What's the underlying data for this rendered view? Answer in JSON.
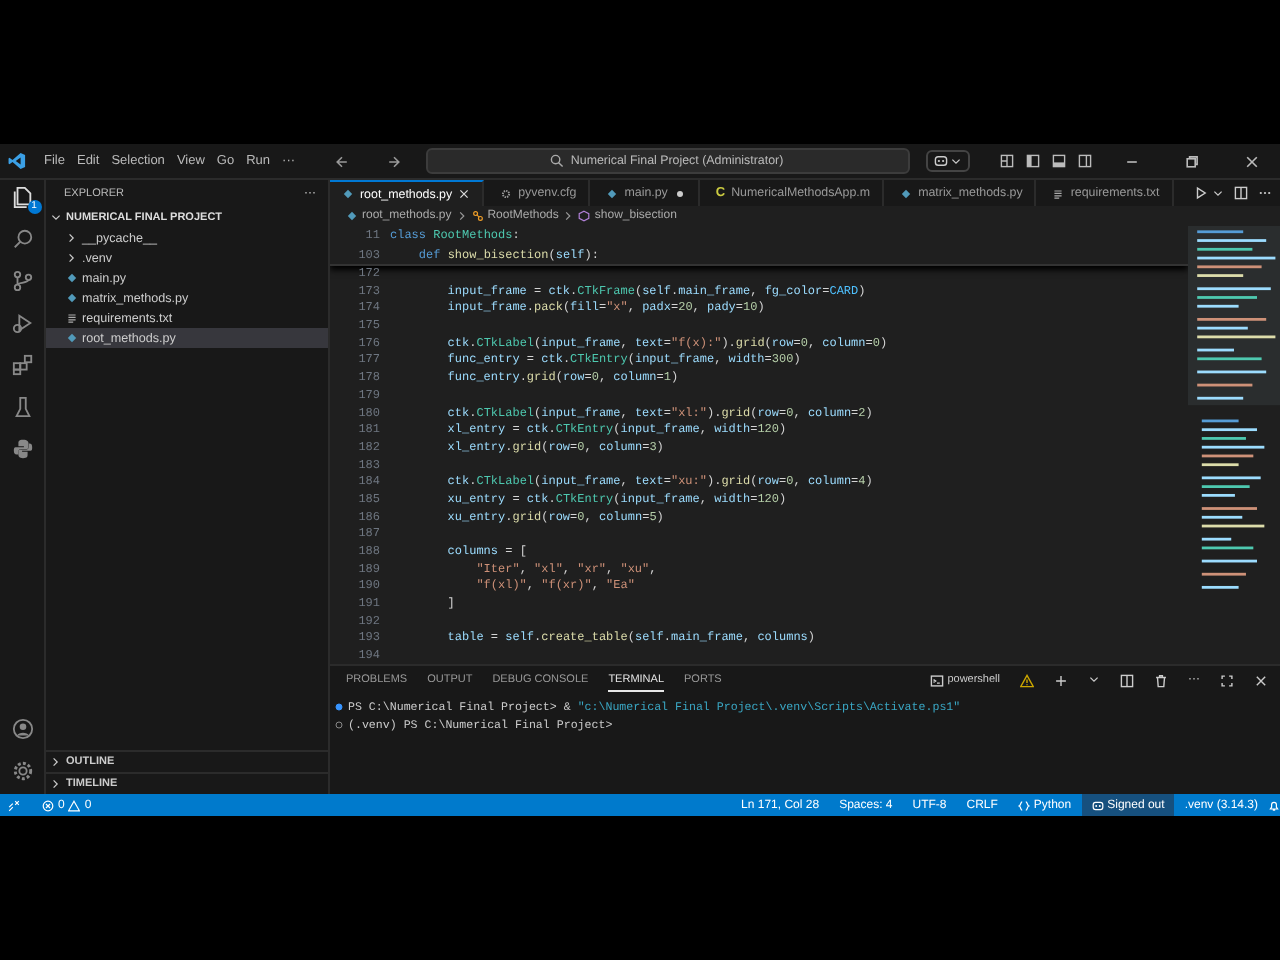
{
  "title_bar": {
    "menus": [
      "File",
      "Edit",
      "Selection",
      "View",
      "Go",
      "Run"
    ],
    "more": "···",
    "search": "Numerical Final Project (Administrator)"
  },
  "activity_bar": {
    "badge": "1"
  },
  "explorer": {
    "title": "EXPLORER",
    "more": "···",
    "project": {
      "label": "NUMERICAL FINAL PROJECT",
      "expanded": true,
      "children": [
        {
          "label": "__pycache__",
          "kind": "folder",
          "expanded": false,
          "selected": false
        },
        {
          "label": ".venv",
          "kind": "folder",
          "expanded": false,
          "selected": false
        },
        {
          "label": "main.py",
          "kind": "py",
          "selected": false
        },
        {
          "label": "matrix_methods.py",
          "kind": "py",
          "selected": false
        },
        {
          "label": "requirements.txt",
          "kind": "txt",
          "selected": false
        },
        {
          "label": "root_methods.py",
          "kind": "py",
          "selected": true
        }
      ]
    },
    "sections": [
      {
        "label": "OUTLINE",
        "expanded": false
      },
      {
        "label": "TIMELINE",
        "expanded": false
      }
    ]
  },
  "tabs": [
    {
      "label": "root_methods.py",
      "kind": "py",
      "selected": true,
      "modified": false
    },
    {
      "label": "pyvenv.cfg",
      "kind": "cfg",
      "selected": false,
      "modified": false
    },
    {
      "label": "main.py",
      "kind": "py",
      "selected": false,
      "modified": true
    },
    {
      "label": "NumericalMethodsApp.m",
      "kind": "letter",
      "letter": "C",
      "selected": false,
      "modified": false
    },
    {
      "label": "matrix_methods.py",
      "kind": "py",
      "selected": false,
      "modified": false
    },
    {
      "label": "requirements.txt",
      "kind": "txt",
      "selected": false,
      "modified": false
    }
  ],
  "breadcrumb": [
    {
      "label": "root_methods.py",
      "kind": "py"
    },
    {
      "label": "RootMethods",
      "kind": "class"
    },
    {
      "label": "show_bisection",
      "kind": "method"
    }
  ],
  "sticky_lines": [
    {
      "number": "11",
      "tokens": [
        {
          "text": "class ",
          "kind": "kw"
        },
        {
          "text": "RootMethods",
          "kind": "cls"
        },
        {
          "text": ":",
          "kind": "op"
        }
      ]
    },
    {
      "number": "103",
      "tokens": [
        {
          "text": "    def ",
          "kind": "kw"
        },
        {
          "text": "show_bisection",
          "kind": "fn"
        },
        {
          "text": "(",
          "kind": "op"
        },
        {
          "text": "self",
          "kind": "var"
        },
        {
          "text": "):",
          "kind": "op"
        }
      ]
    }
  ],
  "code_lines": [
    {
      "number": "172"
    },
    {
      "number": "173",
      "tokens": [
        {
          "text": "        input_frame",
          "kind": "var"
        },
        {
          "text": " = ",
          "kind": "op"
        },
        {
          "text": "ctk",
          "kind": "var"
        },
        {
          "text": ".",
          "kind": "op"
        },
        {
          "text": "CTkFrame",
          "kind": "cls"
        },
        {
          "text": "(",
          "kind": "op"
        },
        {
          "text": "self",
          "kind": "var"
        },
        {
          "text": ".",
          "kind": "op"
        },
        {
          "text": "main_frame",
          "kind": "var"
        },
        {
          "text": ", ",
          "kind": "op"
        },
        {
          "text": "fg_color",
          "kind": "var"
        },
        {
          "text": "=",
          "kind": "op"
        },
        {
          "text": "CARD",
          "kind": "const"
        },
        {
          "text": ")",
          "kind": "op"
        }
      ]
    },
    {
      "number": "174",
      "tokens": [
        {
          "text": "        input_frame",
          "kind": "var"
        },
        {
          "text": ".",
          "kind": "op"
        },
        {
          "text": "pack",
          "kind": "fn"
        },
        {
          "text": "(",
          "kind": "op"
        },
        {
          "text": "fill",
          "kind": "var"
        },
        {
          "text": "=",
          "kind": "op"
        },
        {
          "text": "\"x\"",
          "kind": "str"
        },
        {
          "text": ", ",
          "kind": "op"
        },
        {
          "text": "padx",
          "kind": "var"
        },
        {
          "text": "=",
          "kind": "op"
        },
        {
          "text": "20",
          "kind": "num"
        },
        {
          "text": ", ",
          "kind": "op"
        },
        {
          "text": "pady",
          "kind": "var"
        },
        {
          "text": "=",
          "kind": "op"
        },
        {
          "text": "10",
          "kind": "num"
        },
        {
          "text": ")",
          "kind": "op"
        }
      ]
    },
    {
      "number": "175"
    },
    {
      "number": "176",
      "tokens": [
        {
          "text": "        ctk",
          "kind": "var"
        },
        {
          "text": ".",
          "kind": "op"
        },
        {
          "text": "CTkLabel",
          "kind": "cls"
        },
        {
          "text": "(",
          "kind": "op"
        },
        {
          "text": "input_frame",
          "kind": "var"
        },
        {
          "text": ", ",
          "kind": "op"
        },
        {
          "text": "text",
          "kind": "var"
        },
        {
          "text": "=",
          "kind": "op"
        },
        {
          "text": "\"f(x):\"",
          "kind": "str"
        },
        {
          "text": ").",
          "kind": "op"
        },
        {
          "text": "grid",
          "kind": "fn"
        },
        {
          "text": "(",
          "kind": "op"
        },
        {
          "text": "row",
          "kind": "var"
        },
        {
          "text": "=",
          "kind": "op"
        },
        {
          "text": "0",
          "kind": "num"
        },
        {
          "text": ", ",
          "kind": "op"
        },
        {
          "text": "column",
          "kind": "var"
        },
        {
          "text": "=",
          "kind": "op"
        },
        {
          "text": "0",
          "kind": "num"
        },
        {
          "text": ")",
          "kind": "op"
        }
      ]
    },
    {
      "number": "177",
      "tokens": [
        {
          "text": "        func_entry",
          "kind": "var"
        },
        {
          "text": " = ",
          "kind": "op"
        },
        {
          "text": "ctk",
          "kind": "var"
        },
        {
          "text": ".",
          "kind": "op"
        },
        {
          "text": "CTkEntry",
          "kind": "cls"
        },
        {
          "text": "(",
          "kind": "op"
        },
        {
          "text": "input_frame",
          "kind": "var"
        },
        {
          "text": ", ",
          "kind": "op"
        },
        {
          "text": "width",
          "kind": "var"
        },
        {
          "text": "=",
          "kind": "op"
        },
        {
          "text": "300",
          "kind": "num"
        },
        {
          "text": ")",
          "kind": "op"
        }
      ]
    },
    {
      "number": "178",
      "tokens": [
        {
          "text": "        func_entry",
          "kind": "var"
        },
        {
          "text": ".",
          "kind": "op"
        },
        {
          "text": "grid",
          "kind": "fn"
        },
        {
          "text": "(",
          "kind": "op"
        },
        {
          "text": "row",
          "kind": "var"
        },
        {
          "text": "=",
          "kind": "op"
        },
        {
          "text": "0",
          "kind": "num"
        },
        {
          "text": ", ",
          "kind": "op"
        },
        {
          "text": "column",
          "kind": "var"
        },
        {
          "text": "=",
          "kind": "op"
        },
        {
          "text": "1",
          "kind": "num"
        },
        {
          "text": ")",
          "kind": "op"
        }
      ]
    },
    {
      "number": "179"
    },
    {
      "number": "180",
      "tokens": [
        {
          "text": "        ctk",
          "kind": "var"
        },
        {
          "text": ".",
          "kind": "op"
        },
        {
          "text": "CTkLabel",
          "kind": "cls"
        },
        {
          "text": "(",
          "kind": "op"
        },
        {
          "text": "input_frame",
          "kind": "var"
        },
        {
          "text": ", ",
          "kind": "op"
        },
        {
          "text": "text",
          "kind": "var"
        },
        {
          "text": "=",
          "kind": "op"
        },
        {
          "text": "\"xl:\"",
          "kind": "str"
        },
        {
          "text": ").",
          "kind": "op"
        },
        {
          "text": "grid",
          "kind": "fn"
        },
        {
          "text": "(",
          "kind": "op"
        },
        {
          "text": "row",
          "kind": "var"
        },
        {
          "text": "=",
          "kind": "op"
        },
        {
          "text": "0",
          "kind": "num"
        },
        {
          "text": ", ",
          "kind": "op"
        },
        {
          "text": "column",
          "kind": "var"
        },
        {
          "text": "=",
          "kind": "op"
        },
        {
          "text": "2",
          "kind": "num"
        },
        {
          "text": ")",
          "kind": "op"
        }
      ]
    },
    {
      "number": "181",
      "tokens": [
        {
          "text": "        xl_entry",
          "kind": "var"
        },
        {
          "text": " = ",
          "kind": "op"
        },
        {
          "text": "ctk",
          "kind": "var"
        },
        {
          "text": ".",
          "kind": "op"
        },
        {
          "text": "CTkEntry",
          "kind": "cls"
        },
        {
          "text": "(",
          "kind": "op"
        },
        {
          "text": "input_frame",
          "kind": "var"
        },
        {
          "text": ", ",
          "kind": "op"
        },
        {
          "text": "width",
          "kind": "var"
        },
        {
          "text": "=",
          "kind": "op"
        },
        {
          "text": "120",
          "kind": "num"
        },
        {
          "text": ")",
          "kind": "op"
        }
      ]
    },
    {
      "number": "182",
      "tokens": [
        {
          "text": "        xl_entry",
          "kind": "var"
        },
        {
          "text": ".",
          "kind": "op"
        },
        {
          "text": "grid",
          "kind": "fn"
        },
        {
          "text": "(",
          "kind": "op"
        },
        {
          "text": "row",
          "kind": "var"
        },
        {
          "text": "=",
          "kind": "op"
        },
        {
          "text": "0",
          "kind": "num"
        },
        {
          "text": ", ",
          "kind": "op"
        },
        {
          "text": "column",
          "kind": "var"
        },
        {
          "text": "=",
          "kind": "op"
        },
        {
          "text": "3",
          "kind": "num"
        },
        {
          "text": ")",
          "kind": "op"
        }
      ]
    },
    {
      "number": "183"
    },
    {
      "number": "184",
      "tokens": [
        {
          "text": "        ctk",
          "kind": "var"
        },
        {
          "text": ".",
          "kind": "op"
        },
        {
          "text": "CTkLabel",
          "kind": "cls"
        },
        {
          "text": "(",
          "kind": "op"
        },
        {
          "text": "input_frame",
          "kind": "var"
        },
        {
          "text": ", ",
          "kind": "op"
        },
        {
          "text": "text",
          "kind": "var"
        },
        {
          "text": "=",
          "kind": "op"
        },
        {
          "text": "\"xu:\"",
          "kind": "str"
        },
        {
          "text": ").",
          "kind": "op"
        },
        {
          "text": "grid",
          "kind": "fn"
        },
        {
          "text": "(",
          "kind": "op"
        },
        {
          "text": "row",
          "kind": "var"
        },
        {
          "text": "=",
          "kind": "op"
        },
        {
          "text": "0",
          "kind": "num"
        },
        {
          "text": ", ",
          "kind": "op"
        },
        {
          "text": "column",
          "kind": "var"
        },
        {
          "text": "=",
          "kind": "op"
        },
        {
          "text": "4",
          "kind": "num"
        },
        {
          "text": ")",
          "kind": "op"
        }
      ]
    },
    {
      "number": "185",
      "tokens": [
        {
          "text": "        xu_entry",
          "kind": "var"
        },
        {
          "text": " = ",
          "kind": "op"
        },
        {
          "text": "ctk",
          "kind": "var"
        },
        {
          "text": ".",
          "kind": "op"
        },
        {
          "text": "CTkEntry",
          "kind": "cls"
        },
        {
          "text": "(",
          "kind": "op"
        },
        {
          "text": "input_frame",
          "kind": "var"
        },
        {
          "text": ", ",
          "kind": "op"
        },
        {
          "text": "width",
          "kind": "var"
        },
        {
          "text": "=",
          "kind": "op"
        },
        {
          "text": "120",
          "kind": "num"
        },
        {
          "text": ")",
          "kind": "op"
        }
      ]
    },
    {
      "number": "186",
      "tokens": [
        {
          "text": "        xu_entry",
          "kind": "var"
        },
        {
          "text": ".",
          "kind": "op"
        },
        {
          "text": "grid",
          "kind": "fn"
        },
        {
          "text": "(",
          "kind": "op"
        },
        {
          "text": "row",
          "kind": "var"
        },
        {
          "text": "=",
          "kind": "op"
        },
        {
          "text": "0",
          "kind": "num"
        },
        {
          "text": ", ",
          "kind": "op"
        },
        {
          "text": "column",
          "kind": "var"
        },
        {
          "text": "=",
          "kind": "op"
        },
        {
          "text": "5",
          "kind": "num"
        },
        {
          "text": ")",
          "kind": "op"
        }
      ]
    },
    {
      "number": "187"
    },
    {
      "number": "188",
      "tokens": [
        {
          "text": "        columns",
          "kind": "var"
        },
        {
          "text": " = [",
          "kind": "op"
        }
      ]
    },
    {
      "number": "189",
      "tokens": [
        {
          "text": "            \"Iter\"",
          "kind": "str"
        },
        {
          "text": ", ",
          "kind": "op"
        },
        {
          "text": "\"xl\"",
          "kind": "str"
        },
        {
          "text": ", ",
          "kind": "op"
        },
        {
          "text": "\"xr\"",
          "kind": "str"
        },
        {
          "text": ", ",
          "kind": "op"
        },
        {
          "text": "\"xu\"",
          "kind": "str"
        },
        {
          "text": ",",
          "kind": "op"
        }
      ]
    },
    {
      "number": "190",
      "tokens": [
        {
          "text": "            \"f(xl)\"",
          "kind": "str"
        },
        {
          "text": ", ",
          "kind": "op"
        },
        {
          "text": "\"f(xr)\"",
          "kind": "str"
        },
        {
          "text": ", ",
          "kind": "op"
        },
        {
          "text": "\"Ea\"",
          "kind": "str"
        }
      ]
    },
    {
      "number": "191",
      "tokens": [
        {
          "text": "        ]",
          "kind": "op"
        }
      ]
    },
    {
      "number": "192"
    },
    {
      "number": "193",
      "tokens": [
        {
          "text": "        table",
          "kind": "var"
        },
        {
          "text": " = ",
          "kind": "op"
        },
        {
          "text": "self",
          "kind": "var"
        },
        {
          "text": ".",
          "kind": "op"
        },
        {
          "text": "create_table",
          "kind": "fn"
        },
        {
          "text": "(",
          "kind": "op"
        },
        {
          "text": "self",
          "kind": "var"
        },
        {
          "text": ".",
          "kind": "op"
        },
        {
          "text": "main_frame",
          "kind": "var"
        },
        {
          "text": ", ",
          "kind": "op"
        },
        {
          "text": "columns",
          "kind": "var"
        },
        {
          "text": ")",
          "kind": "op"
        }
      ]
    },
    {
      "number": "194"
    }
  ],
  "panel": {
    "tabs": [
      {
        "label": "PROBLEMS",
        "selected": false
      },
      {
        "label": "OUTPUT",
        "selected": false
      },
      {
        "label": "DEBUG CONSOLE",
        "selected": false
      },
      {
        "label": "TERMINAL",
        "selected": true
      },
      {
        "label": "PORTS",
        "selected": false
      }
    ],
    "shell": "powershell",
    "more": "···",
    "terminal_lines": [
      {
        "finished": true,
        "tokens": [
          {
            "text": "PS C:\\Numerical Final Project> & ",
            "kind": "plain"
          },
          {
            "text": "\"c:\\Numerical Final Project\\.venv\\Scripts\\Activate.ps1\"",
            "kind": "str"
          }
        ]
      },
      {
        "finished": false,
        "tokens": [
          {
            "text": "(.venv) PS C:\\Numerical Final Project>",
            "kind": "plain"
          }
        ]
      }
    ]
  },
  "status_bar": {
    "errors": "0",
    "warnings": "0",
    "position": "Ln 171, Col 28",
    "indent": "Spaces: 4",
    "encoding": "UTF-8",
    "eol": "CRLF",
    "language": "Python",
    "account": "Signed out",
    "interpreter": ".venv (3.14.3)"
  }
}
